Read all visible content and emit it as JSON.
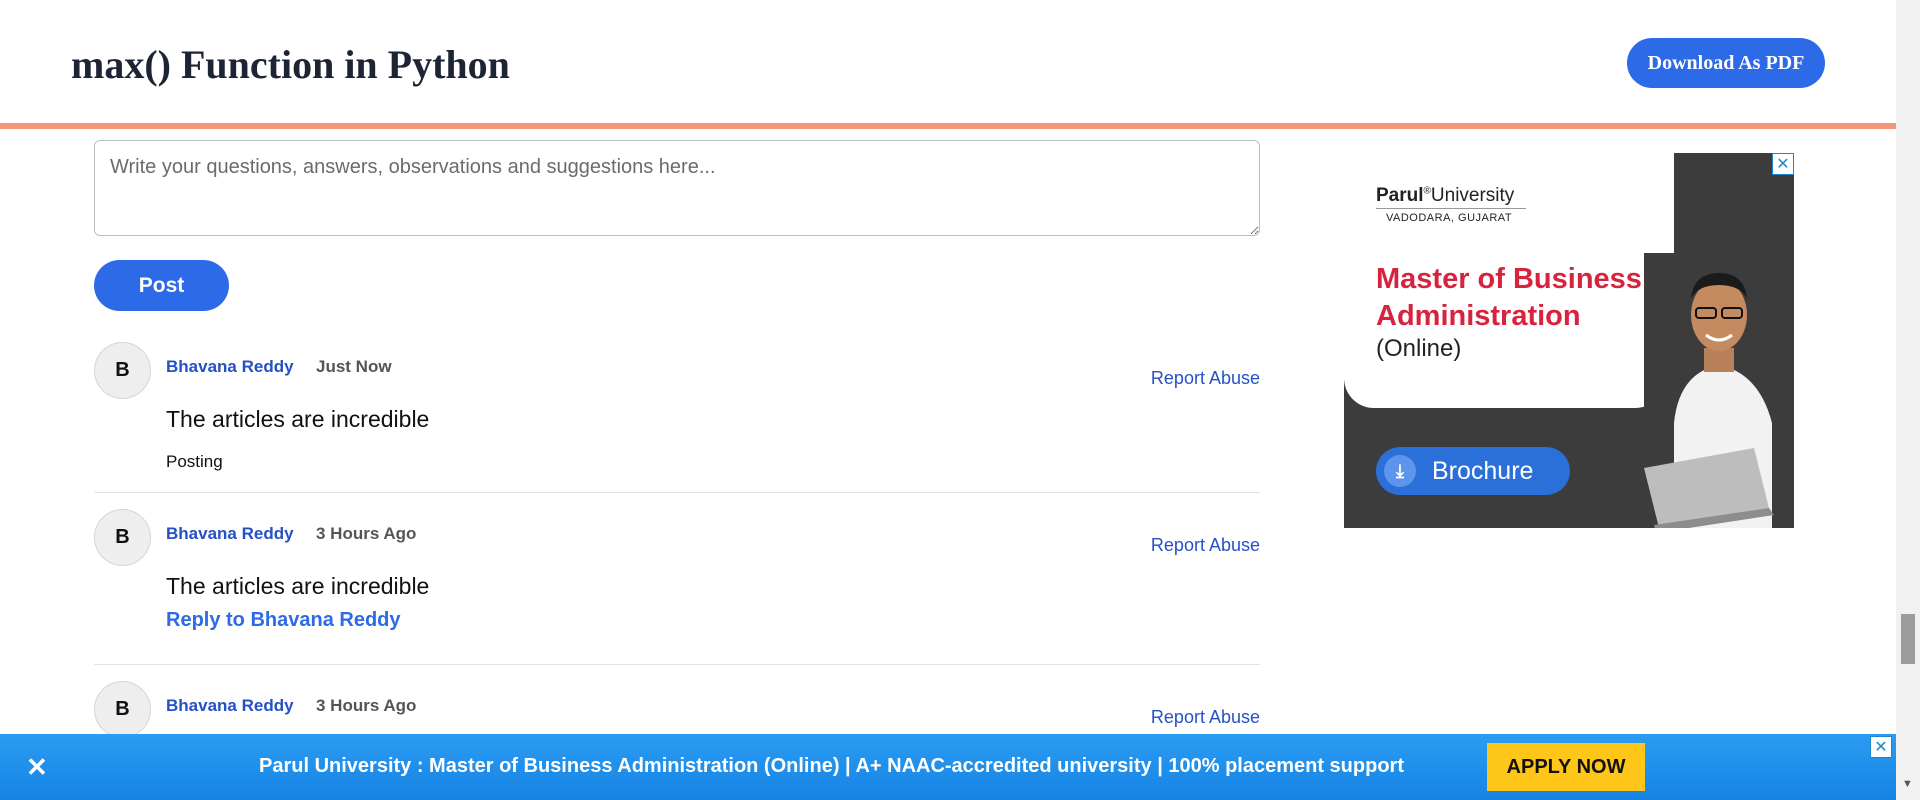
{
  "header": {
    "title": "max() Function in Python",
    "download_label": "Download As PDF"
  },
  "comment_form": {
    "placeholder": "Write your questions, answers, observations and suggestions here...",
    "post_label": "Post"
  },
  "comments": [
    {
      "avatar_letter": "B",
      "author": "Bhavana Reddy",
      "time": "Just Now",
      "report_label": "Report Abuse",
      "text": "The articles are incredible",
      "status": "Posting"
    },
    {
      "avatar_letter": "B",
      "author": "Bhavana Reddy",
      "time": "3 Hours Ago",
      "report_label": "Report Abuse",
      "text": "The articles are incredible",
      "reply_label": "Reply to Bhavana Reddy"
    },
    {
      "avatar_letter": "B",
      "author": "Bhavana Reddy",
      "time": "3 Hours Ago",
      "report_label": "Report Abuse"
    }
  ],
  "ad": {
    "logo_main": "Parul",
    "logo_reg": "®",
    "logo_rest": "University",
    "logo_sub": "VADODARA, GUJARAT",
    "headline": "Master of Business Administration",
    "subline": "(Online)",
    "brochure_label": "Brochure",
    "close_label": "✕"
  },
  "banner": {
    "close_label": "✕",
    "text": "Parul University : Master of Business Administration (Online) | A+ NAAC-accredited university | 100% placement support",
    "apply_label": "APPLY NOW",
    "ad_close_label": "✕"
  },
  "colors": {
    "accent_blue": "#2d6ae8",
    "header_rule": "#f5957a",
    "link_blue": "#2452c6",
    "ad_red": "#d8233f",
    "apply_yellow": "#ffc61a"
  }
}
